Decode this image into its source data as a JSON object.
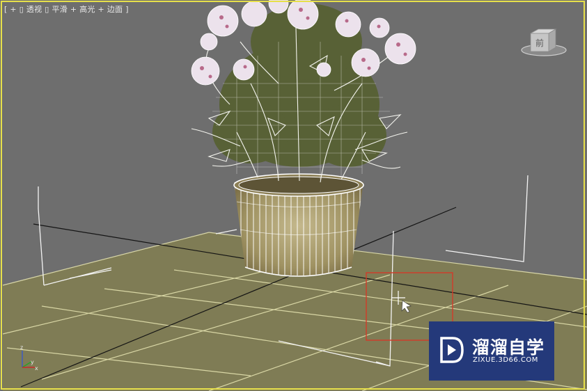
{
  "viewport": {
    "label_bracket_open": "[",
    "label_plus": "+",
    "label_view": "透视",
    "label_shading": "平滑 + 高光 + 边面",
    "label_bracket_close": "]",
    "active_border_color": "#e7e04a"
  },
  "viewcube": {
    "face_label": "前"
  },
  "axis_gizmo": {
    "z": "z",
    "y": "y",
    "x": "x"
  },
  "watermark": {
    "name": "溜溜自学",
    "url": "ZIXUE.3D66.COM"
  },
  "colors": {
    "viewport_bg": "#6e6e6e",
    "ground": "#7f7c55",
    "pot": "#a89a6a",
    "wireframe": "#ffffff",
    "selection_box": "#d23a2a",
    "watermark_bg": "#24397a"
  }
}
